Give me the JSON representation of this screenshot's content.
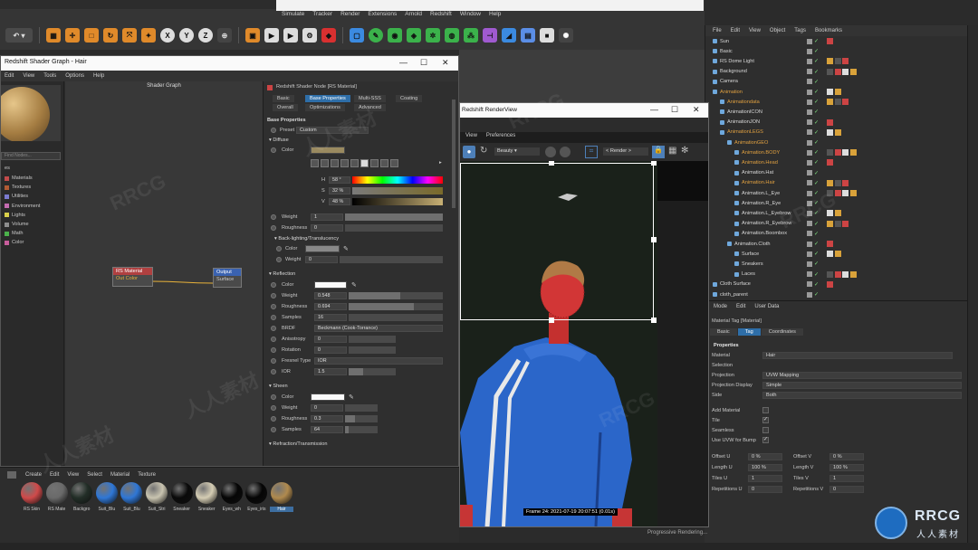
{
  "main_menu": [
    "Simulate",
    "Tracker",
    "Render",
    "Extensions",
    "Arnold",
    "Redshift",
    "Window",
    "Help"
  ],
  "shader_graph": {
    "title": "Redshift Shader Graph - Hair",
    "menu": [
      "Edit",
      "View",
      "Tools",
      "Options",
      "Help"
    ],
    "canvas_header": "Shader Graph",
    "find_placeholder": "Find Nodes...",
    "library_header": "es",
    "library": [
      {
        "label": "Materials",
        "color": "#c24b4b"
      },
      {
        "label": "Textures",
        "color": "#b25b34"
      },
      {
        "label": "Utilities",
        "color": "#7a7ad0"
      },
      {
        "label": "Environment",
        "color": "#c46bb0"
      },
      {
        "label": "Lights",
        "color": "#d9d04a"
      },
      {
        "label": "Volume",
        "color": "#8e8e8e"
      },
      {
        "label": "Math",
        "color": "#4bb24b"
      },
      {
        "label": "Color",
        "color": "#c85e9c"
      }
    ],
    "nodes": {
      "material": {
        "title": "RS Material",
        "port": "Out Color"
      },
      "output": {
        "title": "Output",
        "port": "Surface"
      }
    },
    "props": {
      "node_title": "Redshift Shader Node [RS Material]",
      "tabs_row1": [
        "Basic",
        "Base Properties",
        "Multi-SSS",
        "Coating"
      ],
      "tabs_row2": [
        "Overall",
        "Optimizations",
        "Advanced"
      ],
      "active_tab": "Base Properties",
      "section_base": "Base Properties",
      "preset_label": "Preset",
      "preset_value": "Custom",
      "diffuse": {
        "header": "Diffuse",
        "color_label": "Color",
        "h_label": "H",
        "h_value": "58 °",
        "s_label": "S",
        "s_value": "32 %",
        "v_label": "V",
        "v_value": "48 %",
        "weight_label": "Weight",
        "weight_value": "1",
        "rough_label": "Roughness",
        "rough_value": "0"
      },
      "backlight": {
        "header": "Back-lighting/Translucency",
        "color_label": "Color",
        "weight_label": "Weight",
        "weight_value": "0"
      },
      "reflection": {
        "header": "Reflection",
        "color_label": "Color",
        "weight_label": "Weight",
        "weight_value": "0.548",
        "weight_fill": 0.548,
        "rough_label": "Roughness",
        "rough_value": "0.694",
        "rough_fill": 0.694,
        "samples_label": "Samples",
        "samples_value": "16",
        "brdf_label": "BRDF",
        "brdf_value": "Beckmann (Cook-Torrance)",
        "aniso_label": "Anisotropy",
        "aniso_value": "0",
        "rotation_label": "Rotation",
        "rotation_value": "0",
        "fresnel_label": "Fresnel Type",
        "fresnel_value": "IOR",
        "ior_label": "IOR",
        "ior_value": "1.5"
      },
      "sheen": {
        "header": "Sheen",
        "color_label": "Color",
        "weight_label": "Weight",
        "weight_value": "0",
        "rough_label": "Roughness",
        "rough_value": "0.3",
        "samples_label": "Samples",
        "samples_value": "64"
      },
      "refraction_header": "Refraction/Transmission"
    }
  },
  "render_view": {
    "title": "Redshift RenderView",
    "menu": [
      "View",
      "Preferences"
    ],
    "aov": "Beauty",
    "render_dropdown": "< Render >",
    "status": "Frame  24:  2021-07-19  20:07:51  (0.01s)",
    "progress": "Progressive Rendering..."
  },
  "object_manager": {
    "menu": [
      "File",
      "Edit",
      "View",
      "Object",
      "Tags",
      "Bookmarks"
    ],
    "rows": [
      {
        "name": "Sun",
        "indent": 0,
        "color": "#d9d9d9"
      },
      {
        "name": "Basic",
        "indent": 0,
        "color": "#d9d9d9"
      },
      {
        "name": "RS Dome Light",
        "indent": 0,
        "color": "#d9d9d9"
      },
      {
        "name": "Background",
        "indent": 0,
        "color": "#d9d9d9"
      },
      {
        "name": "Camera",
        "indent": 0,
        "color": "#d9d9d9"
      },
      {
        "name": "Animation",
        "indent": 0,
        "color": "#e0a040"
      },
      {
        "name": "Animationdata",
        "indent": 1,
        "color": "#e0a040"
      },
      {
        "name": "AnimationICON",
        "indent": 1,
        "color": "#d9d9d9"
      },
      {
        "name": "AnimationJON",
        "indent": 1,
        "color": "#d9d9d9"
      },
      {
        "name": "AnimationLEGS",
        "indent": 1,
        "color": "#e0a040"
      },
      {
        "name": "AnimationGEO",
        "indent": 2,
        "color": "#e0a040"
      },
      {
        "name": "Animation.BODY",
        "indent": 3,
        "color": "#e0a040"
      },
      {
        "name": "Animation.Head",
        "indent": 3,
        "color": "#e0a040"
      },
      {
        "name": "Animation.Hat",
        "indent": 3,
        "color": "#d9d9d9"
      },
      {
        "name": "Animation.Hair",
        "indent": 3,
        "color": "#e0a040"
      },
      {
        "name": "Animation.L_Eye",
        "indent": 3,
        "color": "#d9d9d9"
      },
      {
        "name": "Animation.R_Eye",
        "indent": 3,
        "color": "#d9d9d9"
      },
      {
        "name": "Animation.L_Eyebrow",
        "indent": 3,
        "color": "#d9d9d9"
      },
      {
        "name": "Animation.R_Eyebrow",
        "indent": 3,
        "color": "#d9d9d9"
      },
      {
        "name": "Animation.Boombox",
        "indent": 3,
        "color": "#d9d9d9"
      },
      {
        "name": "Animation.Cloth",
        "indent": 2,
        "color": "#d9d9d9"
      },
      {
        "name": "Surface",
        "indent": 3,
        "color": "#d9d9d9"
      },
      {
        "name": "Sneakers",
        "indent": 3,
        "color": "#d9d9d9"
      },
      {
        "name": "Laces",
        "indent": 3,
        "color": "#d9d9d9"
      },
      {
        "name": "Cloth Surface",
        "indent": 0,
        "color": "#d9d9d9"
      },
      {
        "name": "cloth_parent",
        "indent": 0,
        "color": "#d9d9d9"
      }
    ]
  },
  "attributes": {
    "menu": [
      "Mode",
      "Edit",
      "User Data"
    ],
    "title": "Material Tag [Material]",
    "tabs": [
      "Basic",
      "Tag",
      "Coordinates"
    ],
    "active_tab": "Tag",
    "section": "Properties",
    "material_label": "Material",
    "material_value": "Hair",
    "selection_label": "Selection",
    "projection_label": "Projection",
    "projection_value": "UVW Mapping",
    "projection_display_label": "Projection Display",
    "projection_display_value": "Simple",
    "side_label": "Side",
    "side_value": "Both",
    "add_material_label": "Add Material",
    "tile_label": "Tile",
    "seamless_label": "Seamless",
    "use_uvw_label": "Use UVW for Bump",
    "offset_u_label": "Offset U",
    "offset_u_value": "0 %",
    "offset_v_label": "Offset V",
    "offset_v_value": "0 %",
    "length_u_label": "Length U",
    "length_u_value": "100 %",
    "length_v_label": "Length V",
    "length_v_value": "100 %",
    "tiles_u_label": "Tiles U",
    "tiles_u_value": "1",
    "tiles_v_label": "Tiles V",
    "tiles_v_value": "1",
    "rep_u_label": "Repetitions U",
    "rep_u_value": "0",
    "rep_v_label": "Repetitions V",
    "rep_v_value": "0"
  },
  "material_manager": {
    "menu": [
      "Create",
      "Edit",
      "View",
      "Select",
      "Material",
      "Texture"
    ],
    "materials": [
      {
        "label": "RS Skin",
        "color": "#d04a4a"
      },
      {
        "label": "RS Mate",
        "color": "#6a6a6a"
      },
      {
        "label": "Backgro",
        "color": "#222e27"
      },
      {
        "label": "Suit_Blu",
        "color": "#2f77d6"
      },
      {
        "label": "Suit_Blu",
        "color": "#2f77d6"
      },
      {
        "label": "Suit_Stri",
        "color": "#c9c4b0"
      },
      {
        "label": "Sneaker",
        "color": "#0a0a0a"
      },
      {
        "label": "Sneaker",
        "color": "#d5cdb4"
      },
      {
        "label": "Eyes_wh",
        "color": "#050505"
      },
      {
        "label": "Eyes_iris",
        "color": "#050505"
      },
      {
        "label": "Hair",
        "color": "#b08a4e"
      }
    ],
    "selected": "Hair"
  },
  "watermark": [
    "RRCG",
    "人人素材"
  ],
  "logo": {
    "big": "RRCG",
    "small": "人人素材"
  }
}
